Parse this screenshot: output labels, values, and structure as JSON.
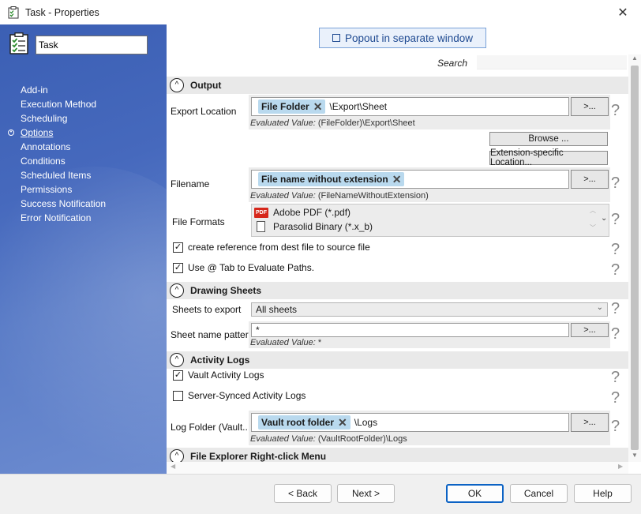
{
  "window": {
    "title": "Task - Properties"
  },
  "left_panel": {
    "task_name": "Task",
    "nav": [
      {
        "label": "Add-in"
      },
      {
        "label": "Execution Method"
      },
      {
        "label": "Scheduling"
      },
      {
        "label": "Options",
        "active": true
      },
      {
        "label": "Annotations"
      },
      {
        "label": "Conditions"
      },
      {
        "label": "Scheduled Items"
      },
      {
        "label": "Permissions"
      },
      {
        "label": "Success Notification"
      },
      {
        "label": "Error Notification"
      }
    ]
  },
  "toolbar": {
    "popout_label": "Popout in separate window",
    "search_label": "Search"
  },
  "sections": {
    "output": {
      "title": "Output",
      "export_location": {
        "label": "Export Location",
        "tag": "File Folder",
        "value": "\\Export\\Sheet",
        "more": ">...",
        "evaluated_label": "Evaluated Value:",
        "evaluated_value": "(FileFolder)\\Export\\Sheet"
      },
      "browse_label": "Browse ...",
      "extension_label": "Extension-specific Location...",
      "filename": {
        "label": "Filename",
        "tag": "File name without extension",
        "more": ">...",
        "evaluated_label": "Evaluated Value:",
        "evaluated_value": "(FileNameWithoutExtension)"
      },
      "file_formats": {
        "label": "File Formats",
        "items": [
          "Adobe PDF (*.pdf)",
          "Parasolid Binary (*.x_b)"
        ]
      },
      "create_reference": {
        "label": "create reference from dest file to source file",
        "checked": true
      },
      "use_tab": {
        "label": "Use @ Tab to Evaluate Paths.",
        "checked": true
      }
    },
    "drawing_sheets": {
      "title": "Drawing Sheets",
      "sheets_to_export": {
        "label": "Sheets to export",
        "value": "All sheets"
      },
      "sheet_name_pattern": {
        "label": "Sheet name pattern",
        "value": "*",
        "more": ">...",
        "evaluated_label": "Evaluated Value:",
        "evaluated_value": "*"
      }
    },
    "activity_logs": {
      "title": "Activity Logs",
      "vault_logs": {
        "label": "Vault Activity Logs",
        "checked": true
      },
      "server_logs": {
        "label": "Server-Synced Activity Logs",
        "checked": false
      },
      "log_folder": {
        "label": "Log Folder (Vault...",
        "tag": "Vault root folder",
        "value": "\\Logs",
        "more": ">...",
        "evaluated_label": "Evaluated Value:",
        "evaluated_value": "(VaultRootFolder)\\Logs"
      }
    },
    "file_explorer": {
      "title": "File Explorer Right-click Menu"
    }
  },
  "footer": {
    "back": "< Back",
    "next": "Next >",
    "ok": "OK",
    "cancel": "Cancel",
    "help": "Help"
  },
  "glyphs": {
    "help": "?",
    "check": "✓",
    "close": "✕",
    "collapse": "^"
  },
  "colors": {
    "left_panel": "#4669bd",
    "tag": "#b9d9ee",
    "popout_text": "#1f4a91",
    "primary_border": "#0b62c4"
  }
}
